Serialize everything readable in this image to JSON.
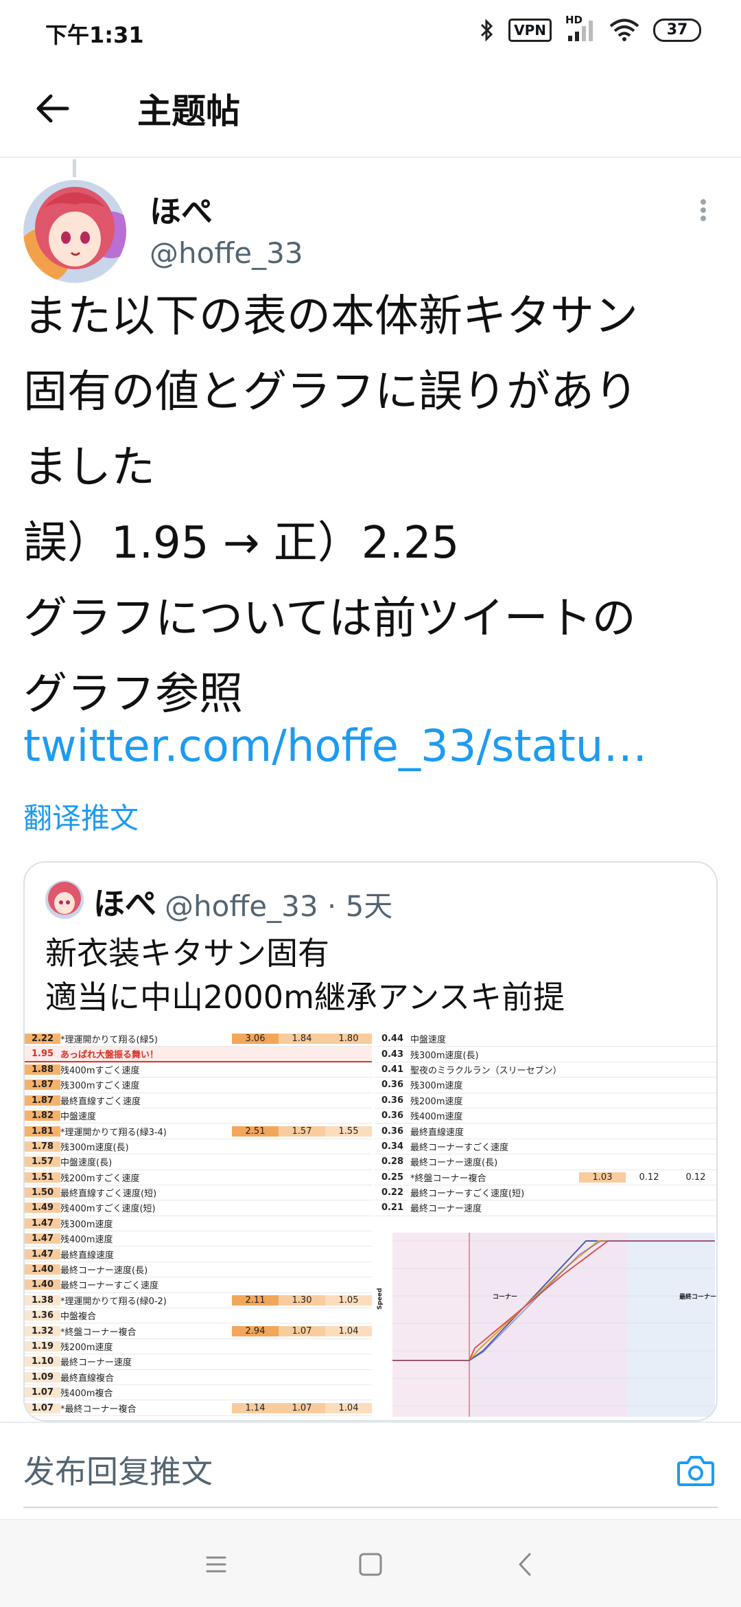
{
  "status_bar": {
    "time": "下午1:31",
    "vpn": "VPN",
    "hd": "HD",
    "battery": "37"
  },
  "header": {
    "title": "主题帖"
  },
  "tweet": {
    "author_name": "ほぺ",
    "author_handle": "@hoffe_33",
    "text_lines": [
      "また以下の表の本体新キタサン",
      "固有の値とグラフに誤りがあり",
      "ました",
      "誤）1.95 → 正）2.25",
      "グラフについては前ツイートの",
      "グラフ参照"
    ],
    "link": "twitter.com/hoffe_33/statu…",
    "translate_label": "翻译推文"
  },
  "quote": {
    "author_name": "ほぺ",
    "author_handle_time": "@hoffe_33 · 5天",
    "text_lines": [
      "新衣装キタサン固有",
      "適当に中山2000m継承アンスキ前提"
    ],
    "sheet_left_rows": [
      {
        "v": "2.22",
        "l": "*理運開かりて翔る(緑5)",
        "n": [
          "3.06",
          "1.84",
          "1.80"
        ],
        "shade": [
          "o1",
          "o2",
          "o2"
        ]
      },
      {
        "v": "1.95",
        "l": "あっぱれ大盤振る舞い！",
        "n": [
          "",
          "",
          ""
        ],
        "hl": true
      },
      {
        "v": "1.88",
        "l": "残400mすごく速度",
        "n": [
          "",
          "",
          ""
        ]
      },
      {
        "v": "1.87",
        "l": "残300mすごく速度",
        "n": [
          "",
          "",
          ""
        ]
      },
      {
        "v": "1.87",
        "l": "最終直線すごく速度",
        "n": [
          "",
          "",
          ""
        ]
      },
      {
        "v": "1.82",
        "l": "中盤速度",
        "n": [
          "",
          "",
          ""
        ]
      },
      {
        "v": "1.81",
        "l": "*理運開かりて翔る(緑3-4)",
        "n": [
          "2.51",
          "1.57",
          "1.55"
        ],
        "shade": [
          "o1",
          "o2",
          "o3"
        ]
      },
      {
        "v": "1.78",
        "l": "残300m速度(長)",
        "n": [
          "",
          "",
          ""
        ]
      },
      {
        "v": "1.57",
        "l": "中盤速度(長)",
        "n": [
          "",
          "",
          ""
        ]
      },
      {
        "v": "1.51",
        "l": "残200mすごく速度",
        "n": [
          "",
          "",
          ""
        ]
      },
      {
        "v": "1.50",
        "l": "最終直線すごく速度(短)",
        "n": [
          "",
          "",
          ""
        ]
      },
      {
        "v": "1.49",
        "l": "残400mすごく速度(短)",
        "n": [
          "",
          "",
          ""
        ]
      },
      {
        "v": "1.47",
        "l": "残300m速度",
        "n": [
          "",
          "",
          ""
        ]
      },
      {
        "v": "1.47",
        "l": "残400m速度",
        "n": [
          "",
          "",
          ""
        ]
      },
      {
        "v": "1.47",
        "l": "最終直線速度",
        "n": [
          "",
          "",
          ""
        ]
      },
      {
        "v": "1.40",
        "l": "最終コーナー速度(長)",
        "n": [
          "",
          "",
          ""
        ]
      },
      {
        "v": "1.40",
        "l": "最終コーナーすごく速度",
        "n": [
          "",
          "",
          ""
        ]
      },
      {
        "v": "1.38",
        "l": "*理運開かりて翔る(緑0-2)",
        "n": [
          "2.11",
          "1.30",
          "1.05"
        ],
        "shade": [
          "o1",
          "o2",
          "o3"
        ]
      },
      {
        "v": "1.36",
        "l": "中盤複合",
        "n": [
          "",
          "",
          ""
        ]
      },
      {
        "v": "1.32",
        "l": "*終盤コーナー複合",
        "n": [
          "2.94",
          "1.07",
          "1.04"
        ],
        "shade": [
          "o1",
          "o2",
          "o3"
        ]
      },
      {
        "v": "1.19",
        "l": "残200m速度",
        "n": [
          "",
          "",
          ""
        ]
      },
      {
        "v": "1.10",
        "l": "最終コーナー速度",
        "n": [
          "",
          "",
          ""
        ]
      },
      {
        "v": "1.09",
        "l": "最終直線複合",
        "n": [
          "",
          "",
          ""
        ]
      },
      {
        "v": "1.07",
        "l": "残400m複合",
        "n": [
          "",
          "",
          ""
        ]
      },
      {
        "v": "1.07",
        "l": "*最終コーナー複合",
        "n": [
          "1.14",
          "1.07",
          "1.04"
        ],
        "shade": [
          "o2",
          "o2",
          "o3"
        ]
      }
    ],
    "sheet_right_rows": [
      {
        "v": "0.44",
        "l": "中盤速度",
        "n": [
          "",
          "",
          ""
        ]
      },
      {
        "v": "0.43",
        "l": "残300m速度(長)",
        "n": [
          "",
          "",
          ""
        ]
      },
      {
        "v": "0.41",
        "l": "聖夜のミラクルラン（スリーセブン）",
        "n": [
          "",
          "",
          ""
        ]
      },
      {
        "v": "0.36",
        "l": "残300m速度",
        "n": [
          "",
          "",
          ""
        ]
      },
      {
        "v": "0.36",
        "l": "残200m速度",
        "n": [
          "",
          "",
          ""
        ]
      },
      {
        "v": "0.36",
        "l": "残400m速度",
        "n": [
          "",
          "",
          ""
        ]
      },
      {
        "v": "0.36",
        "l": "最終直線速度",
        "n": [
          "",
          "",
          ""
        ]
      },
      {
        "v": "0.34",
        "l": "最終コーナーすごく速度",
        "n": [
          "",
          "",
          ""
        ]
      },
      {
        "v": "0.28",
        "l": "最終コーナー速度(長)",
        "n": [
          "",
          "",
          ""
        ]
      },
      {
        "v": "0.25",
        "l": "*終盤コーナー複合",
        "n": [
          "1.03",
          "0.12",
          "0.12"
        ],
        "shade": [
          "o2",
          "",
          ""
        ]
      },
      {
        "v": "0.22",
        "l": "最終コーナーすごく速度(短)",
        "n": [
          "",
          "",
          ""
        ]
      },
      {
        "v": "0.21",
        "l": "最終コーナー速度",
        "n": [
          "",
          "",
          ""
        ]
      }
    ],
    "chart_labels": {
      "corner": "コーナー",
      "final_corner": "最終コーナー",
      "y_axis": "Speed"
    }
  },
  "reply": {
    "placeholder": "发布回复推文"
  },
  "colors": {
    "link": "#1d9bf0",
    "secondary_text": "#536471",
    "border": "#d9e1e6"
  },
  "icons": [
    "back-arrow-icon",
    "more-vertical-icon",
    "camera-icon",
    "bluetooth-icon",
    "signal-icon",
    "wifi-icon",
    "menu-nav-icon",
    "home-nav-icon",
    "back-nav-icon"
  ]
}
